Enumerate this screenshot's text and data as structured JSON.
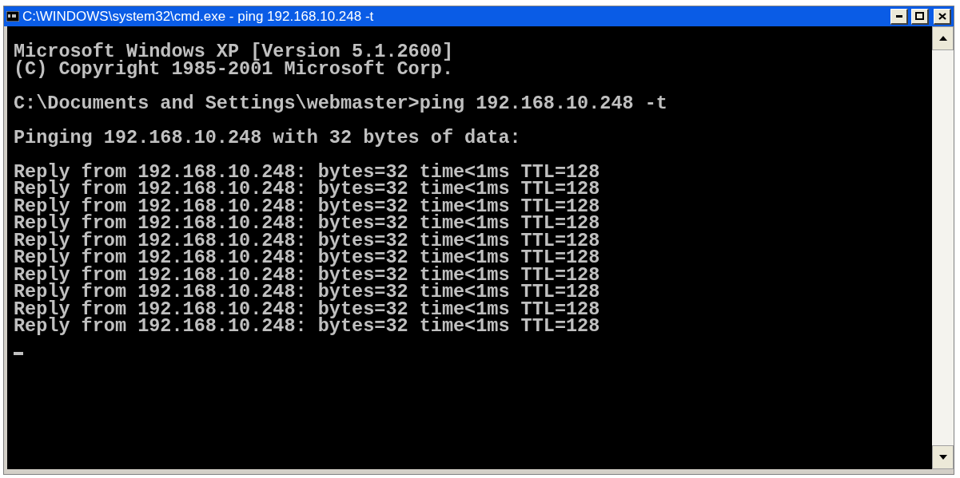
{
  "window": {
    "title": "C:\\WINDOWS\\system32\\cmd.exe - ping 192.168.10.248 -t"
  },
  "console": {
    "blocks": [
      [
        "Microsoft Windows XP [Version 5.1.2600]",
        "(C) Copyright 1985-2001 Microsoft Corp."
      ],
      [
        "C:\\Documents and Settings\\webmaster>ping 192.168.10.248 -t"
      ],
      [
        "Pinging 192.168.10.248 with 32 bytes of data:"
      ],
      [
        "Reply from 192.168.10.248: bytes=32 time<1ms TTL=128",
        "Reply from 192.168.10.248: bytes=32 time<1ms TTL=128",
        "Reply from 192.168.10.248: bytes=32 time<1ms TTL=128",
        "Reply from 192.168.10.248: bytes=32 time<1ms TTL=128",
        "Reply from 192.168.10.248: bytes=32 time<1ms TTL=128",
        "Reply from 192.168.10.248: bytes=32 time<1ms TTL=128",
        "Reply from 192.168.10.248: bytes=32 time<1ms TTL=128",
        "Reply from 192.168.10.248: bytes=32 time<1ms TTL=128",
        "Reply from 192.168.10.248: bytes=32 time<1ms TTL=128",
        "Reply from 192.168.10.248: bytes=32 time<1ms TTL=128"
      ]
    ],
    "cursor_visible": true
  }
}
